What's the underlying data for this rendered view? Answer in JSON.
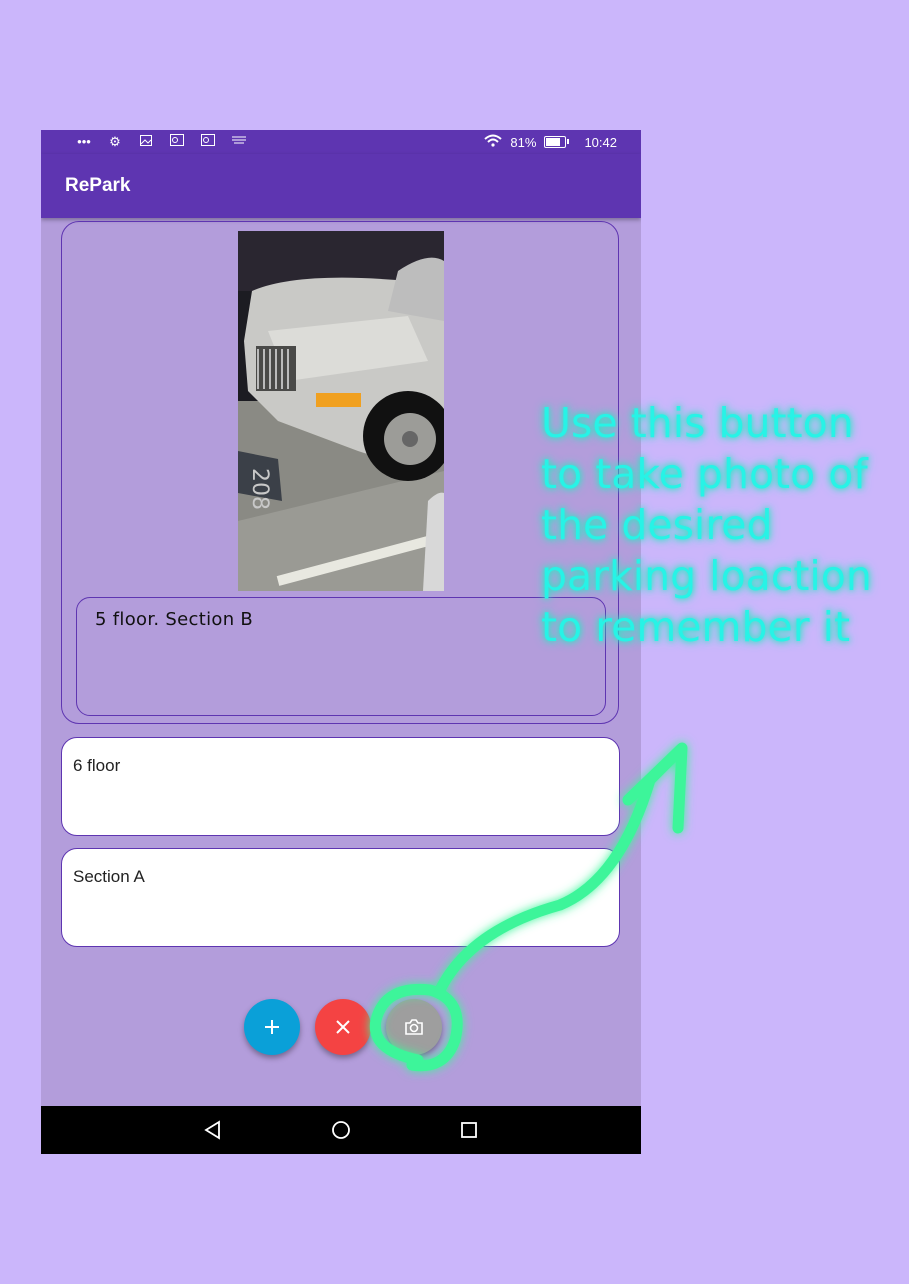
{
  "status_bar": {
    "notification_icons": [
      "more-dots-icon",
      "gear-icon",
      "image-icon",
      "outlook-icon",
      "outlook-icon",
      "amazon-icon"
    ],
    "battery_percent": "81%",
    "time": "10:42"
  },
  "app_bar": {
    "title": "RePark"
  },
  "card": {
    "photo_icon": "parked-car-photo",
    "note": "5 floor.  Section B"
  },
  "fields": [
    {
      "value": "6 floor"
    },
    {
      "value": "Section A"
    }
  ],
  "fabs": {
    "add": {
      "icon": "plus-icon",
      "color": "#0aa0d8"
    },
    "delete": {
      "icon": "close-icon",
      "color": "#f44343"
    },
    "camera": {
      "icon": "camera-icon",
      "color": "#9e9e9e"
    }
  },
  "navigation": [
    "back-icon",
    "home-icon",
    "recents-icon"
  ],
  "annotation": {
    "text": "Use this button to take photo of the desired parking loaction to remember it",
    "color": "#27f3e6",
    "arrow_color": "#3ef59a"
  },
  "colors": {
    "background": "#cbb6fb",
    "app_bar": "#5e35b1",
    "content": "#b39ddb"
  }
}
